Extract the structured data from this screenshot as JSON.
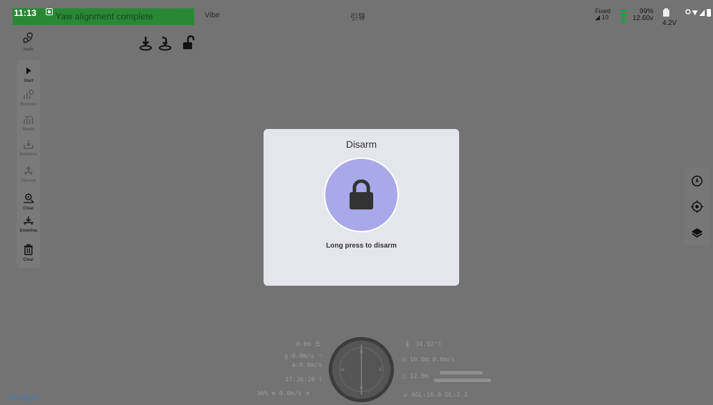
{
  "status": {
    "time": "11:13",
    "banner": "Yaw alignment complete",
    "vibe": "Vibe",
    "guide": "引导",
    "gps_fix": "Fixed",
    "gps_sats": "◢ 10",
    "battery_pct": "99%",
    "battery_voltage": "12.60v",
    "rc_voltage": "4.2V"
  },
  "left_top": {
    "label": "rte/fn"
  },
  "left_toolbar": {
    "items": [
      {
        "label": "Start"
      },
      {
        "label": "Remove"
      },
      {
        "label": "Route"
      },
      {
        "label": "Downloa"
      },
      {
        "label": "Upload"
      },
      {
        "label": "Clear"
      },
      {
        "label": "Downloa"
      },
      {
        "label": "Clear"
      }
    ]
  },
  "dialog": {
    "title": "Disarm",
    "hint": "Long press to disarm"
  },
  "telemetry": {
    "alt_rate": "0.0m",
    "ground_speed": "g:0.0m/s",
    "air_speed": "a:0.0m/s",
    "clock": "17:26:20",
    "throttle": "36%",
    "vertical_speed": "0.0m/s",
    "temperature": "34.92°C",
    "home": "10.0m 0.0m/s",
    "altitude": "12.0m",
    "agl": "AGL:10.0 DL:2.1"
  },
  "compass": {
    "n": "N",
    "e": "E",
    "s": "S",
    "w": "W"
  },
  "map": {
    "attribution": "Google"
  },
  "colors": {
    "dialog_bg": "#e5e5ec",
    "lock_circle": "#a9a8e8",
    "banner": "#1d8c2a"
  }
}
